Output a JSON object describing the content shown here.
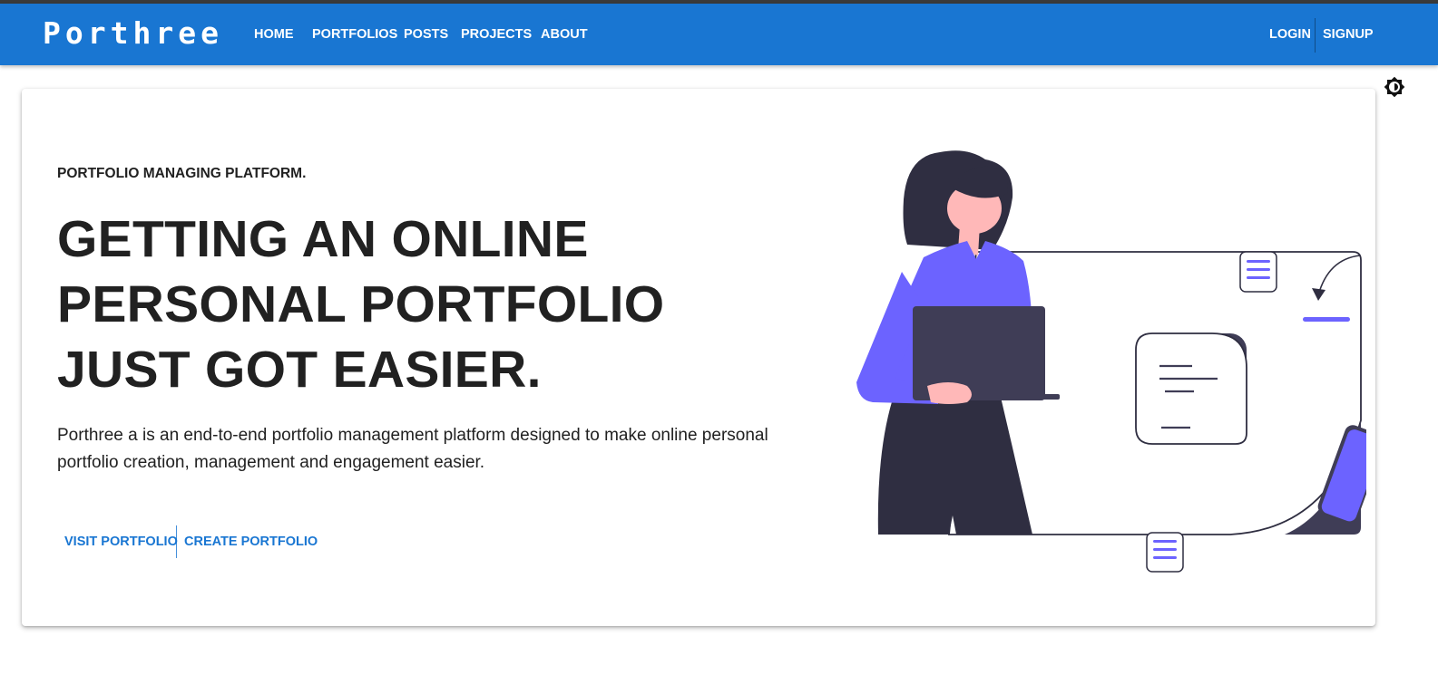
{
  "header": {
    "brand": "Porthree",
    "nav": [
      "HOME",
      "PORTFOLIOS",
      "POSTS",
      "PROJECTS",
      "ABOUT"
    ],
    "login_label": "LOGIN",
    "signup_label": "SIGNUP",
    "theme_icon": "brightness-icon"
  },
  "hero": {
    "kicker": "PORTFOLIO MANAGING PLATFORM.",
    "headline": "GETTING AN ONLINE PERSONAL PORTFOLIO JUST GOT EASIER.",
    "description": "Porthree a is an end-to-end portfolio management platform designed to make online personal portfolio creation, management and engagement easier.",
    "visit_label": "VISIT PORTFOLIO",
    "create_label": "CREATE PORTFOLIO"
  },
  "colors": {
    "appbar": "#1976d2",
    "accent": "#6c63ff",
    "dark": "#2f2e41",
    "text": "#212121"
  }
}
